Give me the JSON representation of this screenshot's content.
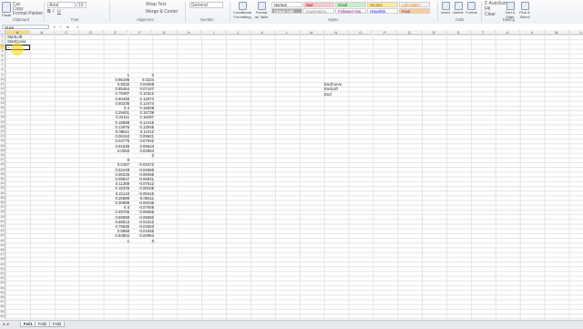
{
  "ribbon": {
    "clipboard": {
      "paste": "Paste",
      "cut": "Cut",
      "copy": "Copy",
      "format_painter": "Format Painter",
      "group": "Clipboard"
    },
    "font": {
      "name": "Arial",
      "size": "10",
      "group": "Font"
    },
    "alignment": {
      "wrap": "Wrap Text",
      "merge": "Merge & Center",
      "group": "Alignment"
    },
    "number": {
      "format": "General",
      "group": "Number"
    },
    "styles": {
      "cond": "Conditional Formatting",
      "table": "Format as Table",
      "normal": "Normal",
      "bad": "Bad",
      "good": "Good",
      "neutral": "Neutral",
      "calculation": "Calculation",
      "check_cell": "Check Cell",
      "explanatory": "Explanatory...",
      "followed": "Followed Hyp...",
      "hyperlink": "Hyperlink",
      "input": "Input",
      "group": "Styles"
    },
    "cells": {
      "insert": "Insert",
      "delete": "Delete",
      "format": "Format",
      "group": "Cells"
    },
    "editing": {
      "autosum": "AutoSum",
      "fill": "Fill",
      "clear": "Clear",
      "sort": "Sort & Filter",
      "find": "Find & Select",
      "group": "Editing"
    }
  },
  "formula_bar": {
    "name_box": "SUM",
    "fx": "fx",
    "content": "="
  },
  "columns": [
    "A",
    "B",
    "C",
    "D",
    "E",
    "F",
    "G",
    "H",
    "I",
    "J",
    "K",
    "L",
    "M",
    "N",
    "O",
    "P",
    "Q",
    "R",
    "S",
    "T",
    "U",
    "V",
    "W",
    "X"
  ],
  "rows": [
    "1",
    "2",
    "3",
    "4",
    "5",
    "6",
    "7",
    "8",
    "9",
    "10",
    "11",
    "12",
    "13",
    "14",
    "15",
    "16",
    "17",
    "18",
    "19",
    "20",
    "21",
    "22",
    "23",
    "24",
    "25",
    "26",
    "27",
    "28",
    "29",
    "30",
    "31",
    "32",
    "33",
    "34",
    "35",
    "36",
    "37",
    "38",
    "39",
    "40",
    "41",
    "42",
    "43",
    "44",
    "45",
    "46",
    "47",
    "48",
    "49",
    "50",
    "51",
    "52",
    "53",
    "54",
    "55",
    "56",
    "57",
    "58",
    "59",
    "60"
  ],
  "cells_a": {
    "a1": "StartLoft",
    "a2": "StartCurve",
    "a3": "="
  },
  "cells_n": {
    "n10": "EndCurve",
    "n11": "EndLoft",
    "n12": "End"
  },
  "col_e": [
    "1",
    "0.95196",
    "0.9032",
    "0.85464",
    "0.79487",
    "0.60455",
    "0.50235",
    "0.4",
    "0.29401",
    "0.24111",
    "0.18658",
    "0.13676",
    "0.08611",
    "0.06153",
    "0.03775",
    "0.01536",
    "0.0053",
    "",
    "0",
    "0.0187",
    "0.03448",
    "0.06225",
    "0.08847",
    "0.11389",
    "0.16329",
    "0.21142",
    "0.25889",
    "0.30699",
    "0.4",
    "0.49765",
    "0.59059",
    "0.68613",
    "0.79636",
    "0.8968",
    "0.94804",
    "1"
  ],
  "col_f": [
    "0",
    "0.0224",
    "0.04059",
    "0.07447",
    "0.10312",
    "0.12674",
    "0.14474",
    "0.15606",
    "0.15739",
    "0.15287",
    "0.14416",
    "0.13045",
    "0.11012",
    "0.09621",
    "0.07942",
    "0.05624",
    "0.03964",
    "0",
    "",
    "-0.03472",
    "-0.04656",
    "-0.06066",
    "-0.06931",
    "-0.07512",
    "-0.08105",
    "-0.08416",
    "-0.08411",
    "-0.08236",
    "-0.07606",
    "-0.06666",
    "-0.05562",
    "-0.04312",
    "-0.03063",
    "-0.01655",
    "-0.00964",
    "0"
  ],
  "sheets": [
    "Foil1",
    "Foil2",
    "Foil3"
  ]
}
